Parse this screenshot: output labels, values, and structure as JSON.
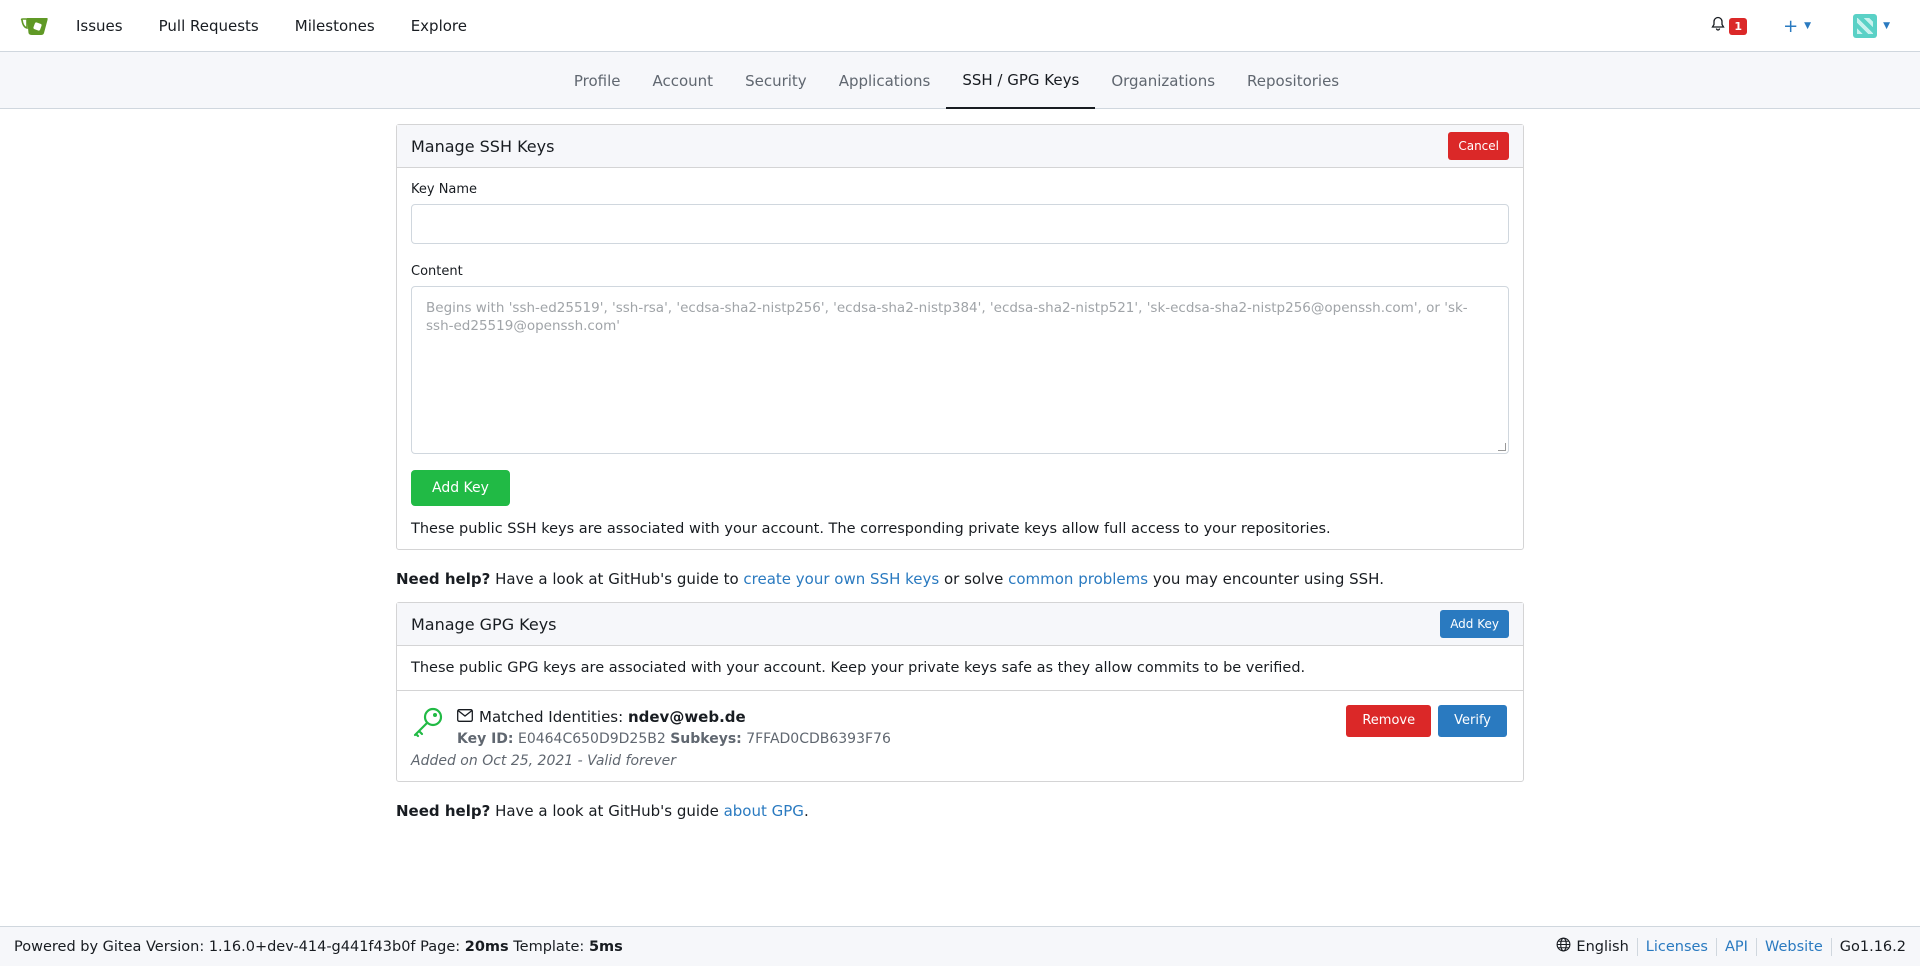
{
  "nav": {
    "items": [
      "Issues",
      "Pull Requests",
      "Milestones",
      "Explore"
    ],
    "notification_count": "1"
  },
  "tabs": [
    "Profile",
    "Account",
    "Security",
    "Applications",
    "SSH / GPG Keys",
    "Organizations",
    "Repositories"
  ],
  "ssh": {
    "title": "Manage SSH Keys",
    "cancel": "Cancel",
    "key_name_label": "Key Name",
    "key_name_value": "",
    "content_label": "Content",
    "content_placeholder": "Begins with 'ssh-ed25519', 'ssh-rsa', 'ecdsa-sha2-nistp256', 'ecdsa-sha2-nistp384', 'ecdsa-sha2-nistp521', 'sk-ecdsa-sha2-nistp256@openssh.com', or 'sk-ssh-ed25519@openssh.com'",
    "add_key": "Add Key",
    "description": "These public SSH keys are associated with your account. The corresponding private keys allow full access to your repositories."
  },
  "ssh_help": {
    "strong": "Need help?",
    "text1": " Have a look at GitHub's guide to ",
    "link1": "create your own SSH keys",
    "text2": " or solve ",
    "link2": "common problems",
    "text3": " you may encounter using SSH."
  },
  "gpg": {
    "title": "Manage GPG Keys",
    "add_key": "Add Key",
    "description": "These public GPG keys are associated with your account. Keep your private keys safe as they allow commits to be verified.",
    "key": {
      "identities_label": "Matched Identities:",
      "identity": "ndev@web.de",
      "key_id_label": "Key ID:",
      "key_id": "E0464C650D9D25B2",
      "subkeys_label": "Subkeys:",
      "subkeys": "7FFAD0CDB6393F76",
      "added": "Added on Oct 25, 2021 - Valid forever",
      "remove": "Remove",
      "verify": "Verify"
    }
  },
  "gpg_help": {
    "strong": "Need help?",
    "text1": " Have a look at GitHub's guide ",
    "link": "about GPG",
    "text2": "."
  },
  "footer": {
    "powered": "Powered by Gitea Version: 1.16.0+dev-414-g441f43b0f Page: ",
    "page_time": "20ms",
    "template_label": " Template: ",
    "template_time": "5ms",
    "language": "English",
    "links": [
      "Licenses",
      "API",
      "Website"
    ],
    "go_version": "Go1.16.2"
  },
  "colors": {
    "danger": "#db2828",
    "primary": "#2a7ac0",
    "success": "#21ba45"
  }
}
